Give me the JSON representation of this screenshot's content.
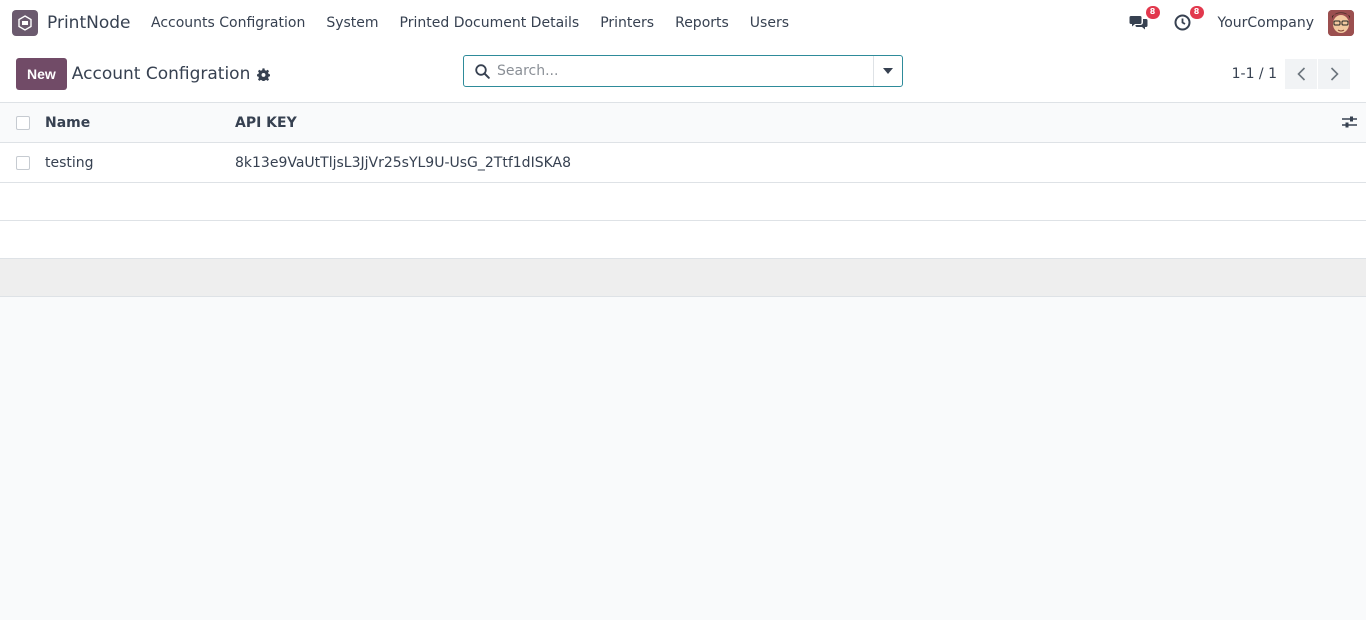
{
  "app": {
    "name": "PrintNode"
  },
  "menu": [
    {
      "label": "Accounts Configration"
    },
    {
      "label": "System"
    },
    {
      "label": "Printed Document Details"
    },
    {
      "label": "Printers"
    },
    {
      "label": "Reports"
    },
    {
      "label": "Users"
    }
  ],
  "systray": {
    "messages_count": "8",
    "activities_count": "8",
    "company": "YourCompany"
  },
  "control": {
    "new_label": "New",
    "title": "Account Configration",
    "search_placeholder": "Search...",
    "pager": "1-1 / 1"
  },
  "table": {
    "columns": [
      "Name",
      "API KEY"
    ],
    "rows": [
      {
        "name": "testing",
        "api_key": "8k13e9VaUtTljsL3JjVr25sYL9U-UsG_2Ttf1dISKA8"
      }
    ]
  },
  "colors": {
    "brand": "#714b67",
    "badge": "#e2384d",
    "focus": "#2e8b9a"
  }
}
